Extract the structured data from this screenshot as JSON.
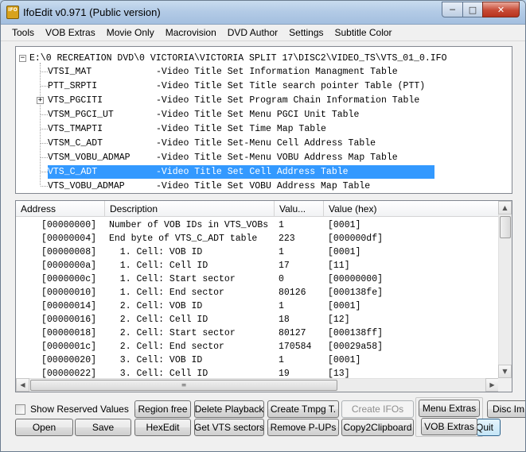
{
  "window": {
    "title": "IfoEdit v0.971 (Public version)",
    "icon_label": "IFO"
  },
  "menu": [
    "Tools",
    "VOB Extras",
    "Movie Only",
    "Macrovision",
    "DVD Author",
    "Settings",
    "Subtitle Color"
  ],
  "tree": {
    "root": "E:\\0 RECREATION DVD\\0 VICTORIA\\VICTORIA SPLIT 17\\DISC2\\VIDEO_TS\\VTS_01_0.IFO",
    "items": [
      {
        "name": "VTSI_MAT",
        "desc": "-Video Title Set Information Managment Table",
        "expandable": false,
        "selected": false
      },
      {
        "name": "PTT_SRPTI",
        "desc": "-Video Title Set Title search pointer Table (PTT)",
        "expandable": false,
        "selected": false
      },
      {
        "name": "VTS_PGCITI",
        "desc": "-Video Title Set Program Chain Information Table",
        "expandable": true,
        "selected": false
      },
      {
        "name": "VTSM_PGCI_UT",
        "desc": "-Video Title Set Menu PGCI Unit Table",
        "expandable": false,
        "selected": false
      },
      {
        "name": "VTS_TMAPTI",
        "desc": "-Video Title Set Time Map Table",
        "expandable": false,
        "selected": false
      },
      {
        "name": "VTSM_C_ADT",
        "desc": "-Video Title Set-Menu Cell Address Table",
        "expandable": false,
        "selected": false
      },
      {
        "name": "VTSM_VOBU_ADMAP",
        "desc": "-Video Title Set-Menu VOBU Address Map Table",
        "expandable": false,
        "selected": false
      },
      {
        "name": "VTS_C_ADT",
        "desc": "-Video Title Set Cell Address Table",
        "expandable": false,
        "selected": true
      },
      {
        "name": "VTS_VOBU_ADMAP",
        "desc": "-Video Title Set VOBU Address Map Table",
        "expandable": false,
        "selected": false
      }
    ]
  },
  "table": {
    "columns": [
      "Address",
      "Description",
      "Valu...",
      "Value (hex)"
    ],
    "rows": [
      {
        "address": "[00000000]",
        "description": "Number of VOB IDs in VTS_VOBs",
        "value": "1",
        "hex": "[0001]"
      },
      {
        "address": "[00000004]",
        "description": "End byte of VTS_C_ADT table",
        "value": "223",
        "hex": "[000000df]"
      },
      {
        "address": "[00000008]",
        "description": "  1. Cell: VOB ID",
        "value": "1",
        "hex": "[0001]"
      },
      {
        "address": "[0000000a]",
        "description": "  1. Cell: Cell ID",
        "value": "17",
        "hex": "[11]"
      },
      {
        "address": "[0000000c]",
        "description": "  1. Cell: Start sector",
        "value": "0",
        "hex": "[00000000]"
      },
      {
        "address": "[00000010]",
        "description": "  1. Cell: End sector",
        "value": "80126",
        "hex": "[000138fe]"
      },
      {
        "address": "[00000014]",
        "description": "  2. Cell: VOB ID",
        "value": "1",
        "hex": "[0001]"
      },
      {
        "address": "[00000016]",
        "description": "  2. Cell: Cell ID",
        "value": "18",
        "hex": "[12]"
      },
      {
        "address": "[00000018]",
        "description": "  2. Cell: Start sector",
        "value": "80127",
        "hex": "[000138ff]"
      },
      {
        "address": "[0000001c]",
        "description": "  2. Cell: End sector",
        "value": "170584",
        "hex": "[00029a58]"
      },
      {
        "address": "[00000020]",
        "description": "  3. Cell: VOB ID",
        "value": "1",
        "hex": "[0001]"
      },
      {
        "address": "[00000022]",
        "description": "  3. Cell: Cell ID",
        "value": "19",
        "hex": "[13]"
      }
    ]
  },
  "checkbox": {
    "label": "Show Reserved Values",
    "checked": false
  },
  "buttons": {
    "region_free": "Region free",
    "delete_playback": "Delete Playback",
    "create_tmpg": "Create Tmpg T.",
    "create_ifos": "Create IFOs",
    "menu_extras": "Menu Extras",
    "disc_image": "Disc Im",
    "open": "Open",
    "save": "Save",
    "hexedit": "HexEdit",
    "get_vts_sectors": "Get VTS sectors",
    "remove_pups": "Remove P-UPs",
    "copy2clipboard": "Copy2Clipboard",
    "vob_extras": "VOB Extras",
    "quit": "Quit"
  },
  "icons": {
    "minimize": "minimize-icon",
    "maximize": "maximize-icon",
    "close": "close-icon"
  },
  "colors": {
    "selection": "#3399ff",
    "titlebar": "#b3cbe6"
  }
}
